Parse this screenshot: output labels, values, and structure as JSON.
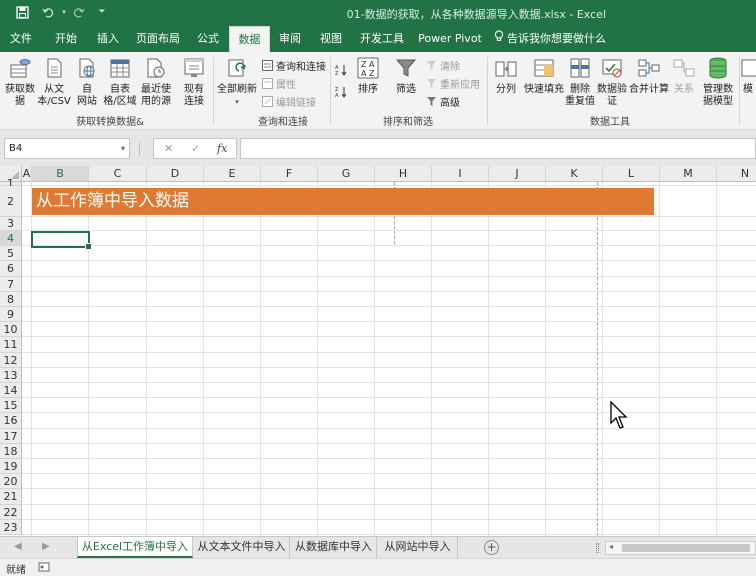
{
  "window": {
    "title": "01-数据的获取，从各种数据源导入数据.xlsx - Excel",
    "quick_access": [
      "save-icon",
      "undo-icon",
      "redo-icon",
      "customize-icon"
    ]
  },
  "ribbon_tabs": [
    {
      "label": "文件"
    },
    {
      "label": "开始"
    },
    {
      "label": "插入"
    },
    {
      "label": "页面布局"
    },
    {
      "label": "公式"
    },
    {
      "label": "数据",
      "active": true
    },
    {
      "label": "审阅"
    },
    {
      "label": "视图"
    },
    {
      "label": "开发工具"
    },
    {
      "label": "Power Pivot"
    },
    {
      "label": "告诉我你想要做什么",
      "icon": "lightbulb-icon"
    }
  ],
  "ribbon": {
    "groups": [
      {
        "label": "获取转换数据&",
        "buttons": [
          {
            "label": "获取数\n据",
            "icon": "get-data-icon"
          },
          {
            "label": "从文\n本/CSV",
            "icon": "text-file-icon"
          },
          {
            "label": "自\n网站",
            "icon": "web-icon"
          },
          {
            "label": "自表\n格/区域",
            "icon": "table-icon"
          },
          {
            "label": "最近使\n用的源",
            "icon": "recent-sources-icon"
          },
          {
            "label": "现有\n连接",
            "icon": "existing-connections-icon"
          }
        ]
      },
      {
        "label": "查询和连接",
        "buttons": [
          {
            "label": "全部刷新",
            "icon": "refresh-all-icon"
          }
        ],
        "small": [
          {
            "label": "查询和连接",
            "disabled": false,
            "icon": "queries-icon"
          },
          {
            "label": "属性",
            "disabled": true,
            "icon": "properties-icon"
          },
          {
            "label": "编辑链接",
            "disabled": true,
            "icon": "edit-links-icon"
          }
        ]
      },
      {
        "label": "排序和筛选",
        "buttons": [
          {
            "label": "排序",
            "icon": "sort-icon"
          },
          {
            "label": "筛选",
            "icon": "filter-icon"
          }
        ],
        "small": [
          {
            "label": "清除",
            "disabled": true,
            "icon": "clear-icon"
          },
          {
            "label": "重新应用",
            "disabled": true,
            "icon": "reapply-icon"
          },
          {
            "label": "高级",
            "disabled": false,
            "icon": "advanced-icon"
          }
        ]
      },
      {
        "label": "数据工具",
        "buttons": [
          {
            "label": "分列",
            "icon": "text-to-columns-icon"
          },
          {
            "label": "快速填充",
            "icon": "flash-fill-icon"
          },
          {
            "label": "删除\n重复值",
            "icon": "remove-duplicates-icon"
          },
          {
            "label": "数据验\n证",
            "icon": "data-validation-icon"
          },
          {
            "label": "合并计算",
            "icon": "consolidate-icon"
          },
          {
            "label": "关系",
            "icon": "relationships-icon",
            "disabled": true
          },
          {
            "label": "管理数\n据模型",
            "icon": "data-model-icon"
          },
          {
            "label": "模",
            "icon": "what-if-icon"
          }
        ]
      }
    ]
  },
  "formula_bar": {
    "name_box": "B4",
    "fx_label": "fx",
    "cancel": "✕",
    "enter": "✓",
    "value": ""
  },
  "grid": {
    "columns": [
      "A",
      "B",
      "C",
      "D",
      "E",
      "F",
      "G",
      "H",
      "I",
      "J",
      "K",
      "L",
      "M",
      "N"
    ],
    "rows": [
      "1",
      "2",
      "3",
      "4",
      "5",
      "6",
      "7",
      "8",
      "9",
      "10",
      "11",
      "12",
      "13",
      "14",
      "15",
      "16",
      "17",
      "18",
      "19",
      "20",
      "21",
      "22",
      "23"
    ],
    "banner_text": "从工作簿中导入数据",
    "banner_color": "#e07a33",
    "active_cell": "B4"
  },
  "sheets": [
    {
      "label": "从Excel工作簿中导入",
      "active": true
    },
    {
      "label": "从文本文件中导入"
    },
    {
      "label": "从数据库中导入"
    },
    {
      "label": "从网站中导入"
    }
  ],
  "add_sheet": "⊕",
  "status": {
    "text": "就绪"
  },
  "theme": {
    "accent": "#217346"
  }
}
